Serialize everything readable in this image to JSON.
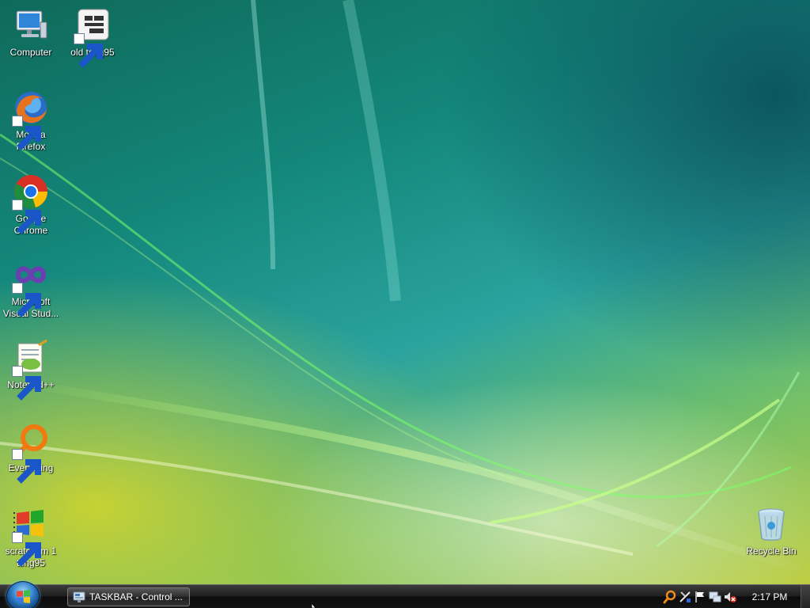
{
  "desktop": {
    "icons": [
      {
        "label": "Computer",
        "icon": "computer-icon"
      },
      {
        "label": "old tsng95",
        "icon": "network-shortcut-icon"
      },
      {
        "label": "Mozilla\nFirefox",
        "icon": "firefox-icon"
      },
      {
        "label": "Google\nChrome",
        "icon": "chrome-icon"
      },
      {
        "label": "Microsoft\nVisual Stud...",
        "icon": "visual-studio-icon"
      },
      {
        "label": "Notepad++",
        "icon": "notepadplusplus-icon"
      },
      {
        "label": "Everything",
        "icon": "everything-search-icon"
      },
      {
        "label": "scratchvm 1\ntsng95",
        "icon": "windows-flag-icon"
      },
      {
        "label": "Recycle Bin",
        "icon": "recycle-bin-icon"
      }
    ]
  },
  "taskbar": {
    "start_button": "start-orb-icon",
    "tasks": [
      {
        "label": "TASKBAR - Control ...",
        "icon": "control-panel-icon"
      }
    ],
    "tray_icons": [
      "search-tray-icon",
      "tools-tray-icon",
      "action-center-flag-icon",
      "network-icon",
      "volume-muted-icon"
    ],
    "clock": "2:17 PM"
  },
  "colors": {
    "accent": "#2f7fc7",
    "taskbar": "#1e1e1e"
  }
}
